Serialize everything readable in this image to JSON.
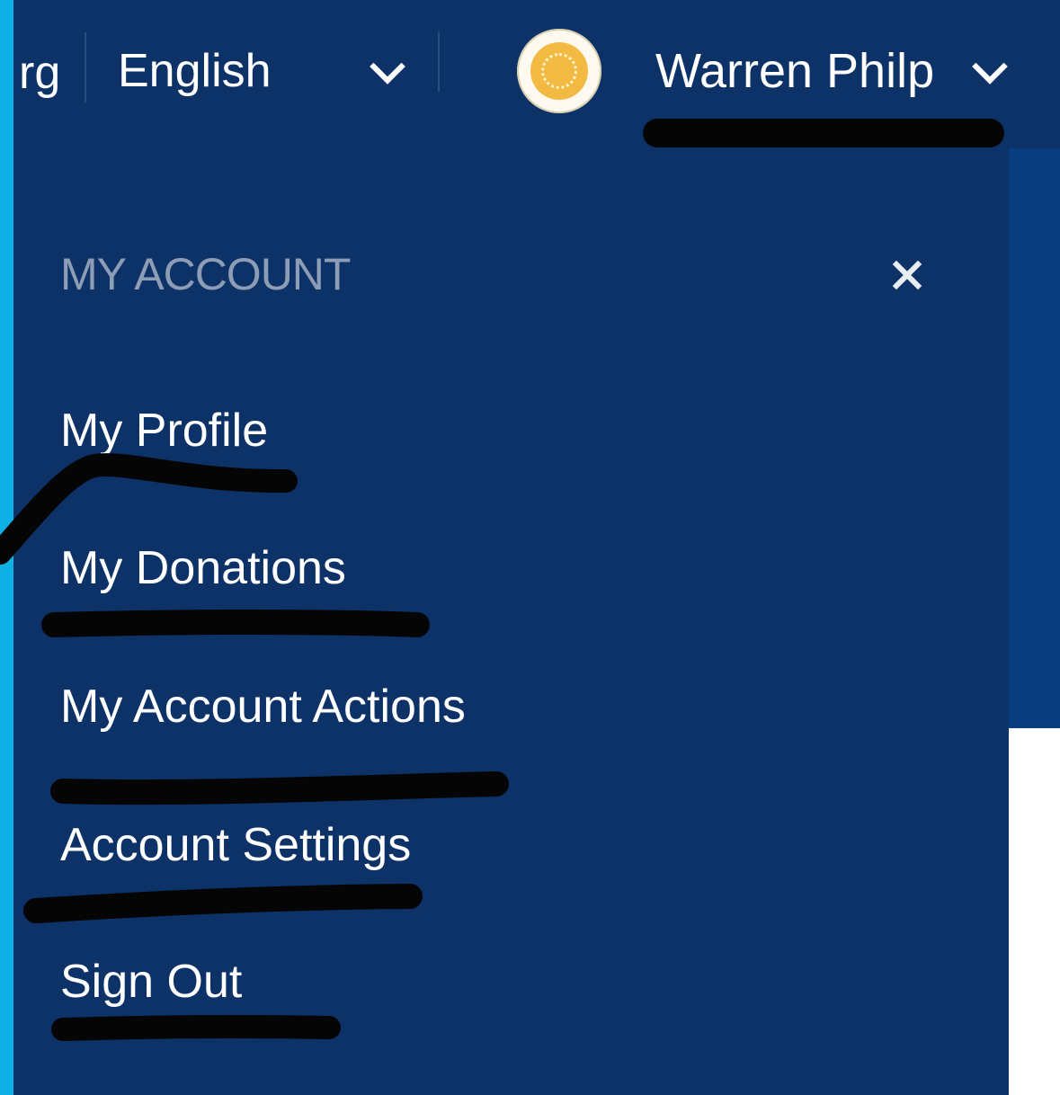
{
  "header": {
    "truncated_text": "rg",
    "language": "English",
    "user_name": "Warren Philp",
    "icons": [
      "chevron-down-icon",
      "avatar-icon"
    ]
  },
  "account_menu": {
    "title": "MY ACCOUNT",
    "items": [
      {
        "label": "My Profile"
      },
      {
        "label": "My Donations"
      },
      {
        "label": "My Account Actions"
      },
      {
        "label": "Account Settings"
      },
      {
        "label": "Sign Out"
      }
    ]
  },
  "colors": {
    "header_bg": "#0c3268",
    "menu_bg": "#0c3268",
    "accent_strip": "#0fb0e6",
    "title_text": "#8d9db6",
    "text": "#ffffff"
  }
}
